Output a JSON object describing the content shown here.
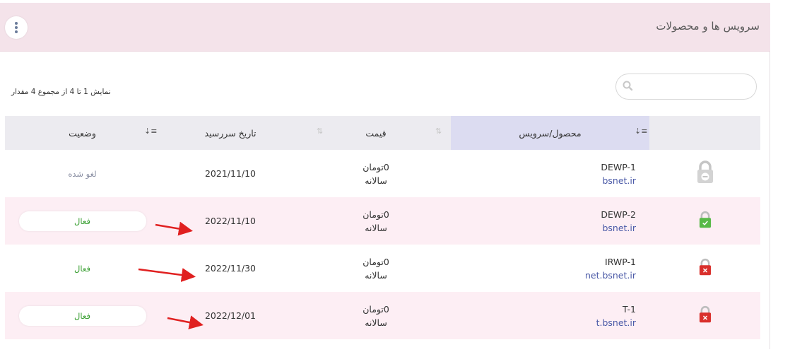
{
  "header": {
    "title": "سرویس ها و محصولات"
  },
  "list": {
    "count_text": "نمایش 1 تا 4 از مجموع 4 مقدار",
    "search_placeholder": ""
  },
  "table": {
    "columns": {
      "product": "محصول/سرویس",
      "price": "قیمت",
      "due_date": "تاریخ سررسید",
      "status": "وضعیت"
    },
    "rows": [
      {
        "name": "DEWP-1",
        "domain": "bsnet.ir",
        "price": "0تومان",
        "cycle": "سالانه",
        "date": "2021/11/10",
        "status": "لغو شده",
        "lock_state": "cancelled",
        "status_style": "cancelled"
      },
      {
        "name": "DEWP-2",
        "domain": "bsnet.ir",
        "price": "0تومان",
        "cycle": "سالانه",
        "date": "2022/11/10",
        "status": "فعال",
        "lock_state": "active",
        "status_style": "pill"
      },
      {
        "name": "IRWP-1",
        "domain": "net.bsnet.ir",
        "price": "0تومان",
        "cycle": "سالانه",
        "date": "2022/11/30",
        "status": "فعال",
        "lock_state": "error",
        "status_style": "plain"
      },
      {
        "name": "T-1",
        "domain": "t.bsnet.ir",
        "price": "0تومان",
        "cycle": "سالانه",
        "date": "2022/12/01",
        "status": "فعال",
        "lock_state": "error",
        "status_style": "pill"
      }
    ]
  },
  "colors": {
    "header_bg": "#f4e3ea",
    "accent_link": "#4b5aa7",
    "active_status": "#3ba034",
    "cancelled_status": "#8a8fa3",
    "arrow": "#e02020"
  }
}
